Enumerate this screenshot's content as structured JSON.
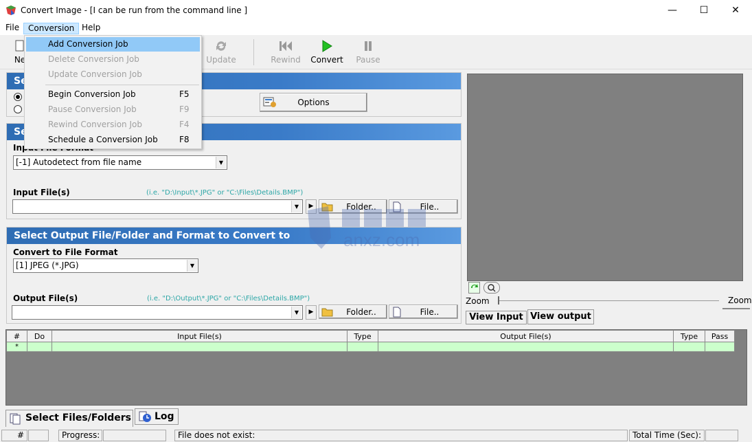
{
  "window": {
    "title": "Convert Image - [I can be run from the command line ]",
    "minimize": "—",
    "maximize": "☐",
    "close": "✕"
  },
  "menubar": {
    "file": "File",
    "conversion": "Conversion",
    "help": "Help"
  },
  "toolbar": {
    "new": "Ne",
    "update": "Update",
    "rewind": "Rewind",
    "convert": "Convert",
    "pause": "Pause"
  },
  "conversion_menu": {
    "add": "Add Conversion Job",
    "delete": "Delete Conversion Job",
    "update": "Update Conversion Job",
    "begin": "Begin Conversion Job",
    "begin_sc": "F5",
    "pause": "Pause Conversion Job",
    "pause_sc": "F9",
    "rewind": "Rewind Conversion Job",
    "rewind_sc": "F4",
    "schedule": "Schedule a Conversion Job",
    "schedule_sc": "F8"
  },
  "section1": {
    "header": "Se",
    "options_label": "Options"
  },
  "section2": {
    "header": "Se",
    "input_format_label": "Input File Format",
    "input_format_value": "[-1] Autodetect from file name",
    "input_files_label": "Input File(s)",
    "input_hint": "(i.e. \"D:\\Input\\*.JPG\"  or  \"C:\\Files\\Details.BMP\")",
    "folder_label": "Folder..",
    "file_label": "File.."
  },
  "section3": {
    "header": "Select Output File/Folder and Format to Convert to",
    "format_label": "Convert to File Format",
    "format_value": "[1] JPEG (*.JPG)",
    "output_files_label": "Output File(s)",
    "output_hint": "(i.e. \"D:\\Output\\*.JPG\"  or  \"C:\\Files\\Details.BMP\")",
    "folder_label": "Folder..",
    "file_label": "File.."
  },
  "preview": {
    "zoom_left": "Zoom",
    "zoom_right": "Zoom",
    "view_input": "View Input",
    "view_output": "View output"
  },
  "grid": {
    "columns": [
      "#",
      "Do",
      "Input File(s)",
      "Type",
      "Output File(s)",
      "Type",
      "Pass"
    ],
    "new_row_marker": "*"
  },
  "tabs": {
    "select_files": "Select Files/Folders",
    "log": "Log"
  },
  "status": {
    "hash": "#",
    "progress": "Progress:",
    "message": "File does not exist:",
    "total_time": "Total Time (Sec):"
  },
  "watermark": {
    "text": "anxz.com"
  },
  "colors": {
    "section_header": "#3a7bc8",
    "grid_row": "#ccffcc",
    "hint": "#2ba6a6",
    "menu_highlight": "#91c9f7"
  }
}
